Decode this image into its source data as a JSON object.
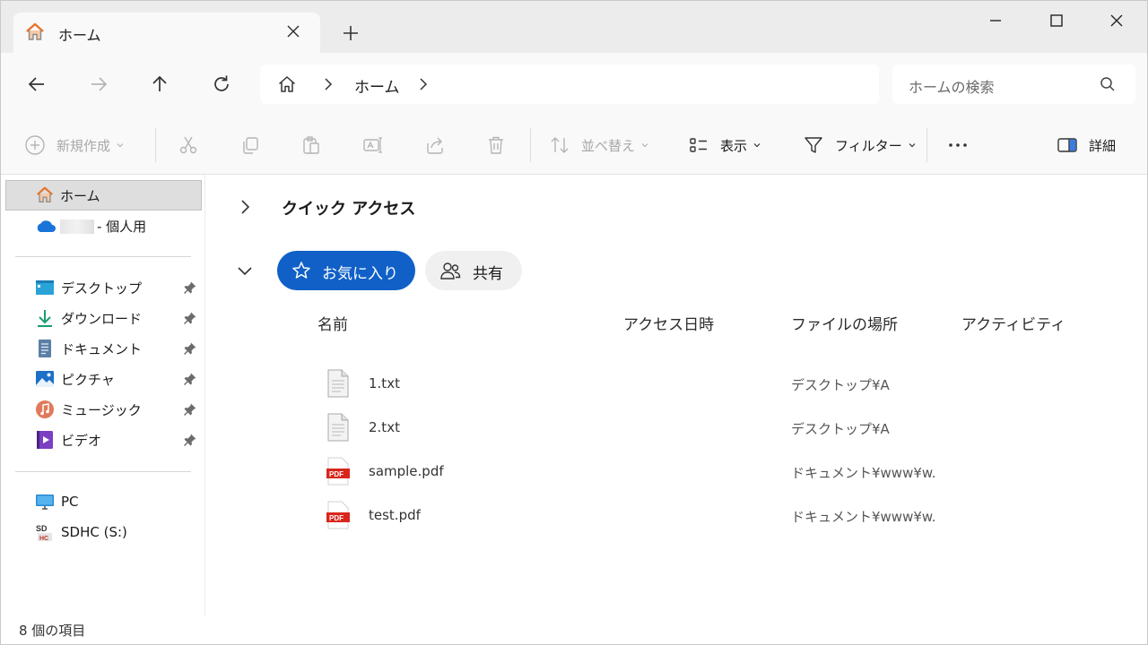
{
  "tab": {
    "title": "ホーム",
    "icon": "home-icon"
  },
  "window_controls": [
    "minimize",
    "maximize",
    "close"
  ],
  "address": {
    "crumb": "ホーム",
    "search_placeholder": "ホームの検索"
  },
  "toolbar": {
    "new_label": "新規作成",
    "sort_label": "並べ替え",
    "view_label": "表示",
    "filter_label": "フィルター",
    "details_label": "詳細"
  },
  "sidebar": {
    "home": "ホーム",
    "onedrive_suffix": "- 個人用",
    "pinned": [
      {
        "label": "デスクトップ",
        "icon": "desktop-icon"
      },
      {
        "label": "ダウンロード",
        "icon": "download-icon"
      },
      {
        "label": "ドキュメント",
        "icon": "document-icon"
      },
      {
        "label": "ピクチャ",
        "icon": "picture-icon"
      },
      {
        "label": "ミュージック",
        "icon": "music-icon"
      },
      {
        "label": "ビデオ",
        "icon": "video-icon"
      }
    ],
    "drives": [
      {
        "label": "PC",
        "icon": "pc-icon"
      },
      {
        "label": "SDHC (S:)",
        "icon": "sd-card-icon"
      }
    ]
  },
  "main": {
    "quick_access_title": "クイック アクセス",
    "favorites_label": "お気に入り",
    "shared_label": "共有",
    "columns": [
      "名前",
      "アクセス日時",
      "ファイルの場所",
      "アクティビティ"
    ],
    "files": [
      {
        "name": "1.txt",
        "location": "デスクトップ¥A",
        "type": "txt"
      },
      {
        "name": "2.txt",
        "location": "デスクトップ¥A",
        "type": "txt"
      },
      {
        "name": "sample.pdf",
        "location": "ドキュメント¥www¥w...",
        "type": "pdf"
      },
      {
        "name": "test.pdf",
        "location": "ドキュメント¥www¥w...",
        "type": "pdf"
      }
    ]
  },
  "status": {
    "item_count": "8 個の項目"
  }
}
